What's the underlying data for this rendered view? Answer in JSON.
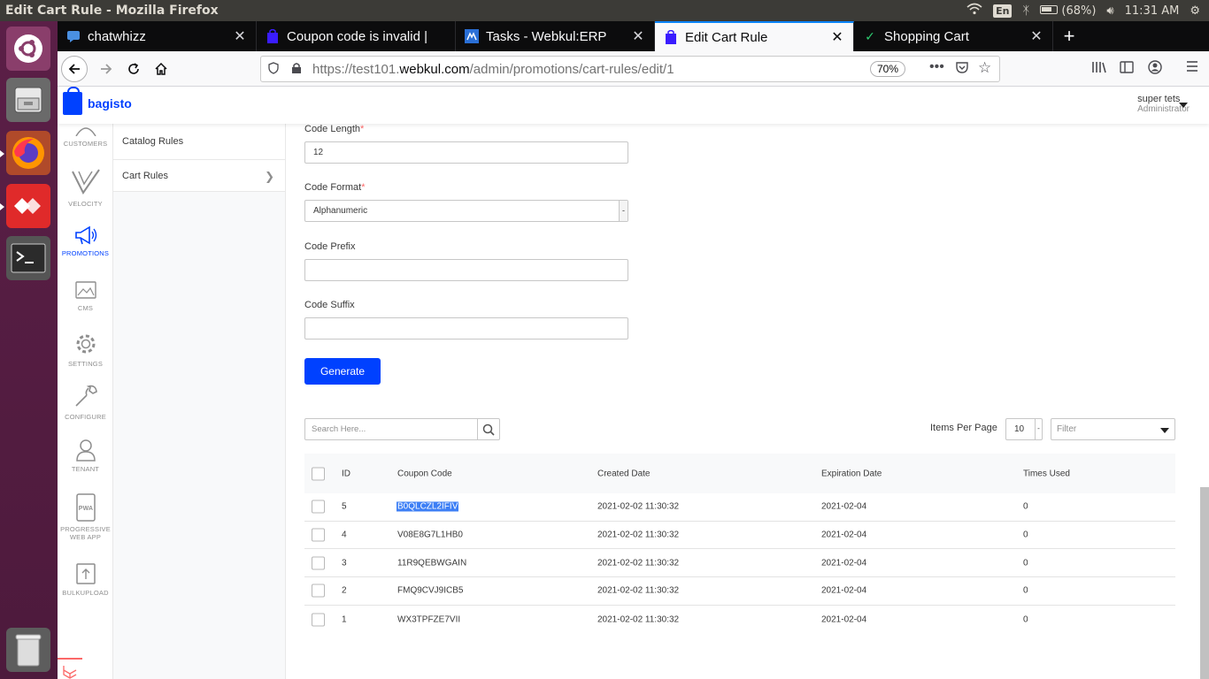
{
  "os": {
    "window_title": "Edit Cart Rule - Mozilla Firefox",
    "lang": "En",
    "battery": "(68%)",
    "time": "11:31 AM"
  },
  "browser": {
    "tabs": [
      {
        "label": "chatwhizz",
        "icon": "chat-favicon"
      },
      {
        "label": "Coupon code is invalid |",
        "icon": "bagisto-favicon"
      },
      {
        "label": "Tasks - Webkul:ERP",
        "icon": "erp-favicon"
      },
      {
        "label": "Edit Cart Rule",
        "icon": "bagisto-favicon",
        "active": true
      },
      {
        "label": "Shopping Cart",
        "icon": "check-favicon"
      }
    ],
    "url_prefix": "https://test101.",
    "url_domain": "webkul.com",
    "url_path": "/admin/promotions/cart-rules/edit/1",
    "zoom": "70%"
  },
  "app": {
    "brand": "bagisto",
    "user_name": "super tets",
    "user_role": "Administrator",
    "nav": [
      {
        "label": "CUSTOMERS",
        "icon": "customers-icon"
      },
      {
        "label": "VELOCITY",
        "icon": "velocity-icon"
      },
      {
        "label": "PROMOTIONS",
        "icon": "megaphone-icon",
        "active": true
      },
      {
        "label": "CMS",
        "icon": "cms-icon"
      },
      {
        "label": "SETTINGS",
        "icon": "gear-icon"
      },
      {
        "label": "CONFIGURE",
        "icon": "wrench-icon"
      },
      {
        "label": "TENANT",
        "icon": "user-icon"
      },
      {
        "label": "PROGRESSIVE",
        "label2": "WEB APP",
        "icon": "pwa-icon"
      },
      {
        "label": "BULKUPLOAD",
        "icon": "upload-icon"
      }
    ],
    "subnav": [
      {
        "label": "Catalog Rules"
      },
      {
        "label": "Cart Rules",
        "active": true
      }
    ]
  },
  "form": {
    "code_length_label": "Code Length",
    "code_length_value": "12",
    "code_format_label": "Code Format",
    "code_format_value": "Alphanumeric",
    "code_prefix_label": "Code Prefix",
    "code_prefix_value": "",
    "code_suffix_label": "Code Suffix",
    "code_suffix_value": "",
    "required_mark": "*",
    "generate_label": "Generate"
  },
  "grid": {
    "search_placeholder": "Search Here...",
    "items_per_page_label": "Items Per Page",
    "items_per_page_value": "10",
    "filter_placeholder": "Filter",
    "columns": [
      "ID",
      "Coupon Code",
      "Created Date",
      "Expiration Date",
      "Times Used"
    ],
    "rows": [
      {
        "id": "5",
        "code": "B0QLCZL2IFIV",
        "created": "2021-02-02 11:30:32",
        "expires": "2021-02-04",
        "used": "0"
      },
      {
        "id": "4",
        "code": "V08E8G7L1HB0",
        "created": "2021-02-02 11:30:32",
        "expires": "2021-02-04",
        "used": "0"
      },
      {
        "id": "3",
        "code": "11R9QEBWGAIN",
        "created": "2021-02-02 11:30:32",
        "expires": "2021-02-04",
        "used": "0"
      },
      {
        "id": "2",
        "code": "FMQ9CVJ9ICB5",
        "created": "2021-02-02 11:30:32",
        "expires": "2021-02-04",
        "used": "0"
      },
      {
        "id": "1",
        "code": "WX3TPFZE7VII",
        "created": "2021-02-02 11:30:32",
        "expires": "2021-02-04",
        "used": "0"
      }
    ]
  },
  "colors": {
    "accent": "#0041ff",
    "launcher": "#5b1f47",
    "required": "#fc6868"
  }
}
